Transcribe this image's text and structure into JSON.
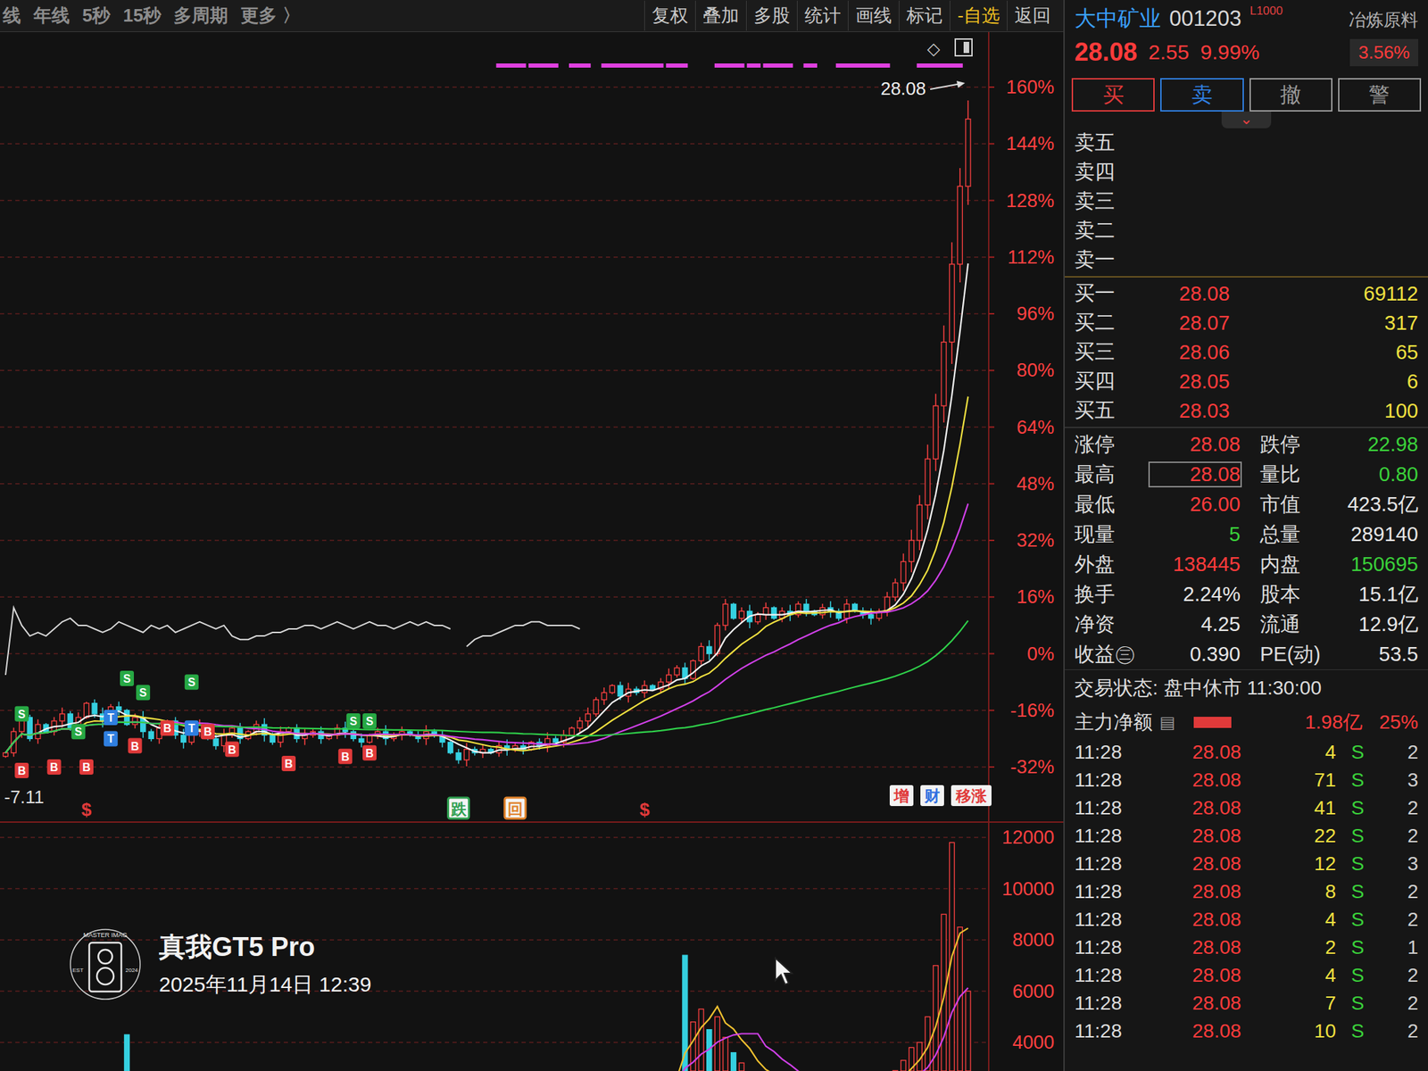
{
  "toolbar": {
    "left": [
      "线",
      "年线",
      "5秒",
      "15秒",
      "多周期",
      "更多 〉"
    ],
    "right": [
      {
        "label": "复权",
        "highlight": false
      },
      {
        "label": "叠加",
        "highlight": false
      },
      {
        "label": "多股",
        "highlight": false
      },
      {
        "label": "统计",
        "highlight": false
      },
      {
        "label": "画线",
        "highlight": false
      },
      {
        "label": "标记",
        "highlight": false
      },
      {
        "label": "-自选",
        "highlight": true
      },
      {
        "label": "返回",
        "highlight": false
      }
    ]
  },
  "chart": {
    "y_ticks": [
      {
        "label": "160%",
        "value": 160
      },
      {
        "label": "144%",
        "value": 144
      },
      {
        "label": "128%",
        "value": 128
      },
      {
        "label": "112%",
        "value": 112
      },
      {
        "label": "96%",
        "value": 96
      },
      {
        "label": "80%",
        "value": 80
      },
      {
        "label": "64%",
        "value": 64
      },
      {
        "label": "48%",
        "value": 48
      },
      {
        "label": "32%",
        "value": 32
      },
      {
        "label": "16%",
        "value": 16
      },
      {
        "label": "0%",
        "value": 0
      },
      {
        "label": "-16%",
        "value": -16
      },
      {
        "label": "-32%",
        "value": -32
      }
    ],
    "price_label": "28.08",
    "corner_icon": "◇",
    "left_value": "-7.11",
    "candles": {
      "close": [
        -28,
        -22,
        -18,
        -24,
        -20,
        -22,
        -19,
        -17,
        -21,
        -18,
        -14,
        -17,
        -19,
        -15,
        -16,
        -20,
        -18,
        -22,
        -24,
        -21,
        -19,
        -23,
        -25,
        -22,
        -20,
        -24,
        -26,
        -23,
        -21,
        -24,
        -22,
        -20,
        -23,
        -25,
        -22,
        -21,
        -24,
        -23,
        -22,
        -24,
        -23,
        -21,
        -22,
        -24,
        -25,
        -23,
        -22,
        -24,
        -23,
        -22,
        -23,
        -24,
        -22,
        -23,
        -25,
        -28,
        -30,
        -27,
        -28,
        -27,
        -28,
        -26,
        -27,
        -26,
        -27,
        -25,
        -26,
        -24,
        -25,
        -23,
        -21,
        -19,
        -17,
        -13,
        -11,
        -9,
        -12,
        -10,
        -11,
        -9,
        -10,
        -8,
        -6,
        -4,
        -7,
        -2,
        2,
        0,
        8,
        14,
        10,
        12,
        9,
        11,
        13,
        10,
        12,
        11,
        14,
        12,
        11,
        13,
        12,
        10,
        14,
        12,
        11,
        10,
        12,
        16,
        20,
        26,
        32,
        42,
        55,
        70,
        88,
        110,
        132,
        151
      ]
    },
    "ma": [
      {
        "period": 5,
        "color": "#f2f2f2"
      },
      {
        "period": 10,
        "color": "#f0e040"
      },
      {
        "period": 20,
        "color": "#d040e8"
      },
      {
        "period": 60,
        "color": "#2fd04a"
      }
    ],
    "overlay_line": [
      -6,
      13,
      8,
      5,
      6,
      5,
      7,
      9,
      10,
      8,
      8,
      7,
      6,
      7,
      9,
      8,
      7,
      6,
      8,
      7,
      8,
      6,
      7,
      8,
      9,
      8,
      7,
      8,
      5,
      4,
      4,
      5,
      5,
      6,
      6,
      7,
      7,
      8,
      8,
      7,
      8,
      9,
      8,
      7,
      8,
      9,
      8,
      8,
      7,
      8,
      9,
      8,
      9,
      8,
      8,
      7,
      null,
      2,
      4,
      5,
      5,
      6,
      7,
      8,
      8,
      9,
      9,
      8,
      8,
      8,
      8,
      7
    ],
    "strip_ranges": [
      [
        61,
        64
      ],
      [
        65,
        68
      ],
      [
        70,
        72
      ],
      [
        74,
        81
      ],
      [
        82,
        84
      ],
      [
        88,
        91
      ],
      [
        92,
        93
      ],
      [
        94,
        97
      ],
      [
        99,
        100
      ],
      [
        103,
        109
      ],
      [
        113,
        118
      ]
    ],
    "signals": [
      {
        "label": "S",
        "index": 2,
        "value": -17,
        "color": "#27a844"
      },
      {
        "label": "S",
        "index": 9,
        "value": -22,
        "color": "#27a844"
      },
      {
        "label": "S",
        "index": 15,
        "value": -7,
        "color": "#27a844"
      },
      {
        "label": "S",
        "index": 17,
        "value": -11,
        "color": "#27a844"
      },
      {
        "label": "S",
        "index": 23,
        "value": -8,
        "color": "#27a844"
      },
      {
        "label": "S",
        "index": 43,
        "value": -19,
        "color": "#27a844"
      },
      {
        "label": "S",
        "index": 45,
        "value": -19,
        "color": "#27a844"
      },
      {
        "label": "B",
        "index": 2,
        "value": -33,
        "color": "#e03a3a"
      },
      {
        "label": "B",
        "index": 6,
        "value": -32,
        "color": "#e03a3a"
      },
      {
        "label": "B",
        "index": 10,
        "value": -32,
        "color": "#e03a3a"
      },
      {
        "label": "B",
        "index": 16,
        "value": -26,
        "color": "#e03a3a"
      },
      {
        "label": "B",
        "index": 20,
        "value": -21,
        "color": "#e03a3a"
      },
      {
        "label": "B",
        "index": 25,
        "value": -22,
        "color": "#e03a3a"
      },
      {
        "label": "B",
        "index": 28,
        "value": -27,
        "color": "#e03a3a"
      },
      {
        "label": "B",
        "index": 35,
        "value": -31,
        "color": "#e03a3a"
      },
      {
        "label": "B",
        "index": 42,
        "value": -29,
        "color": "#e03a3a"
      },
      {
        "label": "B",
        "index": 45,
        "value": -28,
        "color": "#e03a3a"
      },
      {
        "label": "T",
        "index": 13,
        "value": -18,
        "color": "#2f7fe0"
      },
      {
        "label": "T",
        "index": 13,
        "value": -24,
        "color": "#2f7fe0"
      },
      {
        "label": "T",
        "index": 23,
        "value": -21,
        "color": "#2f7fe0"
      }
    ],
    "bottom_markers": [
      {
        "label": "$",
        "index": 10,
        "kind": "text",
        "color": "#e03a3a"
      },
      {
        "label": "跌",
        "index": 56,
        "kind": "box",
        "color": "#2e9e4f"
      },
      {
        "label": "回",
        "index": 63,
        "kind": "box",
        "color": "#e0822a"
      },
      {
        "label": "$",
        "index": 79,
        "kind": "text",
        "color": "#e03a3a"
      }
    ],
    "top_markers": [
      {
        "label": "增",
        "color": "#e03a3a"
      },
      {
        "label": "财",
        "color": "#2f6fe0"
      },
      {
        "label": "移涨",
        "color": "#e03a3a"
      }
    ]
  },
  "volume": {
    "y_ticks": [
      {
        "label": "12000",
        "value": 12000
      },
      {
        "label": "10000",
        "value": 10000
      },
      {
        "label": "8000",
        "value": 8000
      },
      {
        "label": "6000",
        "value": 6000
      },
      {
        "label": "4000",
        "value": 4000
      }
    ],
    "values": [
      2100,
      2600,
      2400,
      1900,
      2200,
      2500,
      2000,
      1800,
      2300,
      2100,
      2400,
      2200,
      2600,
      2000,
      2300,
      4300,
      2500,
      2200,
      1900,
      2100,
      2000,
      1800,
      2200,
      2400,
      2100,
      1900,
      2000,
      2300,
      1800,
      1700,
      1900,
      2000,
      1800,
      1600,
      1900,
      2100,
      1700,
      1800,
      2000,
      1900,
      1700,
      1800,
      2000,
      1900,
      1600,
      1800,
      1700,
      1900,
      2000,
      1800,
      1700,
      1600,
      1800,
      1900,
      1700,
      2200,
      2600,
      2100,
      1800,
      1600,
      1500,
      1700,
      1600,
      1800,
      1500,
      1700,
      1600,
      1900,
      1800,
      2000,
      2300,
      2500,
      2700,
      2800,
      2600,
      2400,
      2200,
      2500,
      2300,
      2600,
      2400,
      2700,
      2800,
      2600,
      7400,
      4800,
      5300,
      4500,
      5000,
      4200,
      3600,
      3200,
      2800,
      2600,
      2500,
      2700,
      2400,
      2300,
      2500,
      2200,
      2300,
      2100,
      2200,
      2000,
      2400,
      2100,
      2000,
      2200,
      2300,
      2600,
      2900,
      3300,
      3800,
      4000,
      5000,
      7000,
      9000,
      11800,
      8500,
      6000
    ],
    "ma": [
      {
        "period": 5,
        "color": "#f0c030"
      },
      {
        "period": 10,
        "color": "#d040e8"
      }
    ]
  },
  "quote": {
    "name": "大中矿业",
    "code": "001203",
    "level": "L1000",
    "sector": "冶炼原料",
    "price": "28.08",
    "change": "2.55",
    "percent": "9.99%",
    "sector_change": "3.56%",
    "buttons": [
      {
        "label": "买",
        "color": "#e03a3a"
      },
      {
        "label": "卖",
        "color": "#2f7fe0"
      },
      {
        "label": "撤",
        "color": "#9a9a9a"
      },
      {
        "label": "警",
        "color": "#9a9a9a"
      }
    ],
    "expand_icon": "⌄",
    "sell": [
      {
        "label": "卖五"
      },
      {
        "label": "卖四"
      },
      {
        "label": "卖三"
      },
      {
        "label": "卖二"
      },
      {
        "label": "卖一"
      }
    ],
    "buy": [
      {
        "label": "买一",
        "price": "28.08",
        "volume": "69112"
      },
      {
        "label": "买二",
        "price": "28.07",
        "volume": "317"
      },
      {
        "label": "买三",
        "price": "28.06",
        "volume": "65"
      },
      {
        "label": "买四",
        "price": "28.05",
        "volume": "6"
      },
      {
        "label": "买五",
        "price": "28.03",
        "volume": "100"
      }
    ],
    "stats": [
      {
        "left": {
          "label": "涨停",
          "value": "28.08",
          "color": "#ff3b3b",
          "boxed": false
        },
        "right": {
          "label": "跌停",
          "value": "22.98",
          "color": "#3ad13a"
        }
      },
      {
        "left": {
          "label": "最高",
          "value": "28.08",
          "color": "#ff3b3b",
          "boxed": true
        },
        "right": {
          "label": "量比",
          "value": "0.80",
          "color": "#3ad13a"
        }
      },
      {
        "left": {
          "label": "最低",
          "value": "26.00",
          "color": "#ff3b3b",
          "boxed": false
        },
        "right": {
          "label": "市值",
          "value": "423.5亿",
          "color": "#e6e6e6"
        }
      },
      {
        "left": {
          "label": "现量",
          "value": "5",
          "color": "#3ad13a",
          "boxed": false
        },
        "right": {
          "label": "总量",
          "value": "289140",
          "color": "#e6e6e6"
        }
      },
      {
        "left": {
          "label": "外盘",
          "value": "138445",
          "color": "#ff3b3b",
          "boxed": false
        },
        "right": {
          "label": "内盘",
          "value": "150695",
          "color": "#3ad13a"
        }
      },
      {
        "left": {
          "label": "换手",
          "value": "2.24%",
          "color": "#e6e6e6",
          "boxed": false
        },
        "right": {
          "label": "股本",
          "value": "15.1亿",
          "color": "#e6e6e6"
        }
      },
      {
        "left": {
          "label": "净资",
          "value": "4.25",
          "color": "#e6e6e6",
          "boxed": false
        },
        "right": {
          "label": "流通",
          "value": "12.9亿",
          "color": "#e6e6e6"
        }
      },
      {
        "left": {
          "label": "收益㊂",
          "value": "0.390",
          "color": "#e6e6e6",
          "boxed": false
        },
        "right": {
          "label": "PE(动)",
          "value": "53.5",
          "color": "#e6e6e6"
        }
      }
    ],
    "status": "交易状态: 盘中休市 11:30:00",
    "main_flow": {
      "label": "主力净额",
      "icon": "▤",
      "value": "1.98亿",
      "percent": "25%"
    },
    "ticks": [
      {
        "time": "11:28",
        "price": "28.08",
        "volume": "4",
        "side": "S",
        "count": "2"
      },
      {
        "time": "11:28",
        "price": "28.08",
        "volume": "71",
        "side": "S",
        "count": "3"
      },
      {
        "time": "11:28",
        "price": "28.08",
        "volume": "41",
        "side": "S",
        "count": "2"
      },
      {
        "time": "11:28",
        "price": "28.08",
        "volume": "22",
        "side": "S",
        "count": "2"
      },
      {
        "time": "11:28",
        "price": "28.08",
        "volume": "12",
        "side": "S",
        "count": "3"
      },
      {
        "time": "11:28",
        "price": "28.08",
        "volume": "8",
        "side": "S",
        "count": "2"
      },
      {
        "time": "11:28",
        "price": "28.08",
        "volume": "4",
        "side": "S",
        "count": "2"
      },
      {
        "time": "11:28",
        "price": "28.08",
        "volume": "2",
        "side": "S",
        "count": "1"
      },
      {
        "time": "11:28",
        "price": "28.08",
        "volume": "4",
        "side": "S",
        "count": "2"
      },
      {
        "time": "11:28",
        "price": "28.08",
        "volume": "7",
        "side": "S",
        "count": "2"
      },
      {
        "time": "11:28",
        "price": "28.08",
        "volume": "10",
        "side": "S",
        "count": "2"
      }
    ]
  },
  "watermark": {
    "brand": "MASTER IMAG",
    "est": "EST",
    "year": "2024",
    "device": "真我GT5 Pro",
    "datetime": "2025年11月14日 12:39"
  }
}
